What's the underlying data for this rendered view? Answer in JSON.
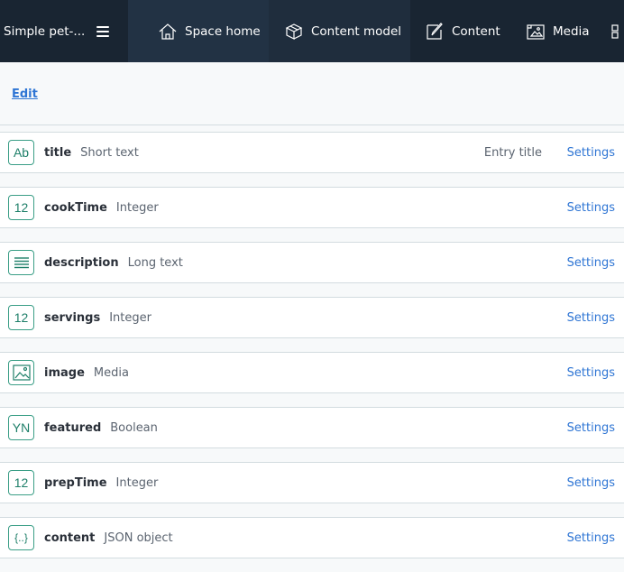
{
  "nav": {
    "space_name": "Simple pet-...",
    "items": [
      {
        "label": "Space home",
        "icon": "home-icon"
      },
      {
        "label": "Content model",
        "icon": "content-model-icon"
      },
      {
        "label": "Content",
        "icon": "content-icon"
      },
      {
        "label": "Media",
        "icon": "media-icon"
      }
    ]
  },
  "toolbar": {
    "edit_label": "Edit"
  },
  "fields": [
    {
      "name": "title",
      "type": "Short text",
      "icon_text": "Ab",
      "entry_title": "Entry title",
      "settings": "Settings"
    },
    {
      "name": "cookTime",
      "type": "Integer",
      "icon_text": "12",
      "settings": "Settings"
    },
    {
      "name": "description",
      "type": "Long text",
      "icon_text": "",
      "settings": "Settings"
    },
    {
      "name": "servings",
      "type": "Integer",
      "icon_text": "12",
      "settings": "Settings"
    },
    {
      "name": "image",
      "type": "Media",
      "icon_text": "",
      "settings": "Settings"
    },
    {
      "name": "featured",
      "type": "Boolean",
      "icon_text": "YN",
      "settings": "Settings"
    },
    {
      "name": "prepTime",
      "type": "Integer",
      "icon_text": "12",
      "settings": "Settings"
    },
    {
      "name": "content",
      "type": "JSON object",
      "icon_text": "{..}",
      "settings": "Settings"
    }
  ],
  "colors": {
    "nav_bg": "#192532",
    "accent_link": "#2e75d4",
    "field_icon": "#3a9e86"
  }
}
